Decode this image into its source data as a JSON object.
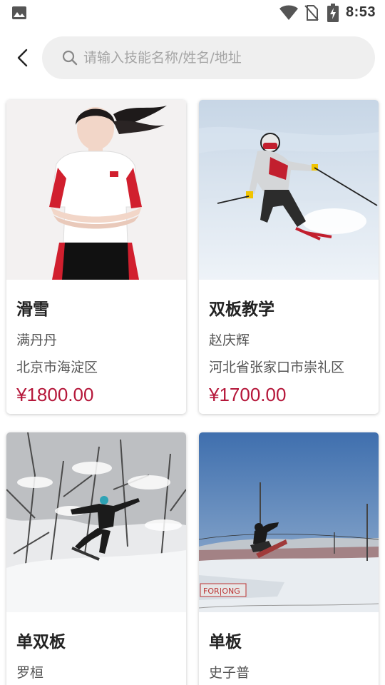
{
  "status_bar": {
    "time": "8:53",
    "icons": [
      "image-icon",
      "wifi-icon",
      "no-sim-icon",
      "battery-charging-icon"
    ]
  },
  "header": {
    "back_icon": "chevron-left-icon",
    "search": {
      "placeholder": "请输入技能名称/姓名/地址",
      "value": "",
      "icon": "search-icon"
    }
  },
  "colors": {
    "price": "#b5173a",
    "search_bg": "#efefef"
  },
  "cards": [
    {
      "title": "滑雪",
      "name": "满丹丹",
      "address": "北京市海淀区",
      "price": "¥1800.00",
      "photo": "instructor-portrait"
    },
    {
      "title": "双板教学",
      "name": "赵庆辉",
      "address": "河北省张家口市崇礼区",
      "price": "¥1700.00",
      "photo": "skier-on-slope"
    },
    {
      "title": "单双板",
      "name": "罗桓",
      "address": "",
      "price": "",
      "photo": "snowboarder-in-forest"
    },
    {
      "title": "单板",
      "name": "史子普",
      "address": "",
      "price": "",
      "photo": "snowboard-jump-park"
    }
  ]
}
